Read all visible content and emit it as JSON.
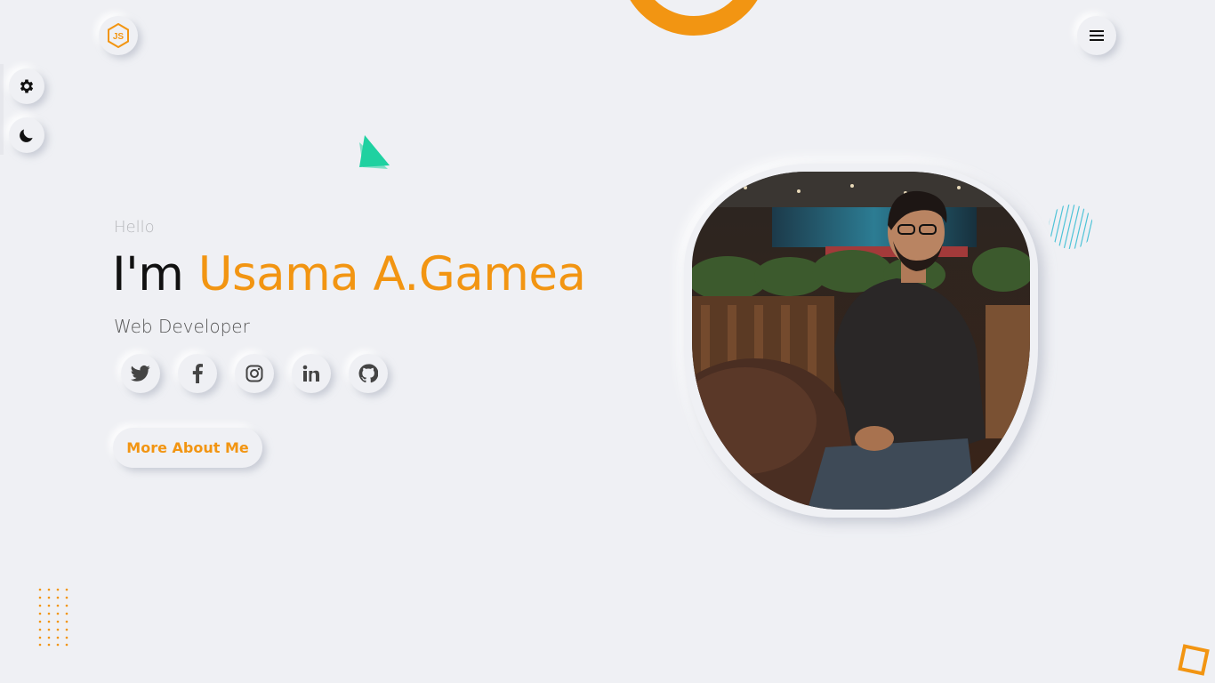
{
  "header": {
    "logo_icon": "nodejs-hexagon-icon",
    "menu_icon": "hamburger-icon"
  },
  "side_panel": {
    "settings_icon": "gear-icon",
    "theme_icon": "moon-icon"
  },
  "hero": {
    "greeting": "Hello",
    "intro": "I'm ",
    "name": "Usama A.Gamea",
    "role": "Web Developer",
    "cta_label": "More About Me"
  },
  "socials": [
    {
      "network": "Twitter",
      "icon": "twitter-icon"
    },
    {
      "network": "Facebook",
      "icon": "facebook-icon"
    },
    {
      "network": "Instagram",
      "icon": "instagram-icon"
    },
    {
      "network": "LinkedIn",
      "icon": "linkedin-icon"
    },
    {
      "network": "GitHub",
      "icon": "github-icon"
    }
  ],
  "colors": {
    "accent": "#f29512",
    "background": "#eff0f4",
    "text": "#111111",
    "muted": "#b6b7bb",
    "teal": "#1fd1a1",
    "cyan": "#4fc3d7"
  },
  "profile_photo": {
    "icon": "profile-photo"
  }
}
